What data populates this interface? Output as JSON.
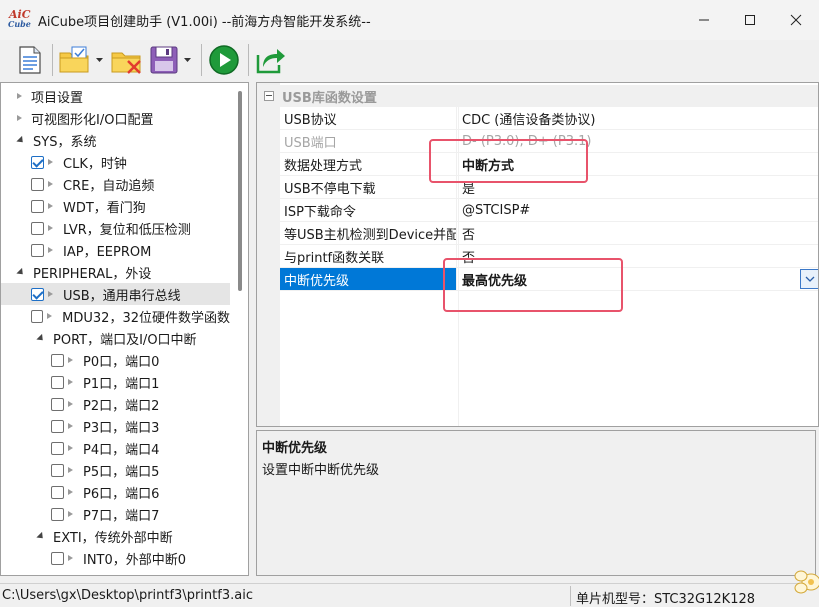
{
  "window": {
    "logo_top": "AiC",
    "logo_bottom": "Cube",
    "title": "AiCube项目创建助手 (V1.00i) --前海方舟智能开发系统--"
  },
  "toolbar": {
    "buttons": [
      "new-document-icon",
      "open-folder-icon",
      "close-project-icon",
      "save-icon",
      "run-icon",
      "export-icon"
    ]
  },
  "tree": {
    "items": [
      {
        "label": "项目设置",
        "kind": "arrow",
        "checked": false
      },
      {
        "label": "可视图形化I/O口配置",
        "kind": "arrow",
        "checked": false
      },
      {
        "label": "SYS，系统",
        "kind": "expanded",
        "checked": false
      },
      {
        "label": "CLK，时钟",
        "kind": "check",
        "checked": true
      },
      {
        "label": "CRE，自动追频",
        "kind": "check",
        "checked": false
      },
      {
        "label": "WDT，看门狗",
        "kind": "check",
        "checked": false
      },
      {
        "label": "LVR，复位和低压检测",
        "kind": "check",
        "checked": false
      },
      {
        "label": "IAP，EEPROM",
        "kind": "check",
        "checked": false
      },
      {
        "label": "PERIPHERAL，外设",
        "kind": "expanded",
        "checked": false
      },
      {
        "label": "USB，通用串行总线",
        "kind": "check",
        "checked": true
      },
      {
        "label": "MDU32，32位硬件数学函数",
        "kind": "check",
        "checked": false
      },
      {
        "label": "PORT，端口及I/O口中断",
        "kind": "expanded",
        "checked": false
      },
      {
        "label": "P0口，端口0",
        "kind": "check",
        "checked": false
      },
      {
        "label": "P1口，端口1",
        "kind": "check",
        "checked": false
      },
      {
        "label": "P2口，端口2",
        "kind": "check",
        "checked": false
      },
      {
        "label": "P3口，端口3",
        "kind": "check",
        "checked": false
      },
      {
        "label": "P4口，端口4",
        "kind": "check",
        "checked": false
      },
      {
        "label": "P5口，端口5",
        "kind": "check",
        "checked": false
      },
      {
        "label": "P6口，端口6",
        "kind": "check",
        "checked": false
      },
      {
        "label": "P7口，端口7",
        "kind": "check",
        "checked": false
      },
      {
        "label": "EXTI，传统外部中断",
        "kind": "expanded",
        "checked": false
      },
      {
        "label": "INT0，外部中断0",
        "kind": "check",
        "checked": false
      }
    ]
  },
  "properties": {
    "category": "USB库函数设置",
    "rows": [
      {
        "name": "USB协议",
        "value": "CDC (通信设备类协议)",
        "state": "normal"
      },
      {
        "name": "USB端口",
        "value": "D- (P3.0), D+ (P3.1)",
        "state": "disabled"
      },
      {
        "name": "数据处理方式",
        "value": "中断方式",
        "state": "bold"
      },
      {
        "name": "USB不停电下载",
        "value": "是",
        "state": "normal"
      },
      {
        "name": "ISP下载命令",
        "value": "@STCISP#",
        "state": "normal"
      },
      {
        "name": "等USB主机检测到Device并配置",
        "value": "否",
        "state": "normal"
      },
      {
        "name": "与printf函数关联",
        "value": "否",
        "state": "normal"
      },
      {
        "name": "中断优先级",
        "value": "最高优先级",
        "state": "selected"
      }
    ]
  },
  "description": {
    "title": "中断优先级",
    "text": "设置中断中断优先级"
  },
  "status": {
    "path": "C:\\Users\\gx\\Desktop\\printf3\\printf3.aic",
    "mcu": "单片机型号：STC32G12K128"
  },
  "colors": {
    "accent": "#0078d7",
    "highlight": "#e8536b"
  }
}
